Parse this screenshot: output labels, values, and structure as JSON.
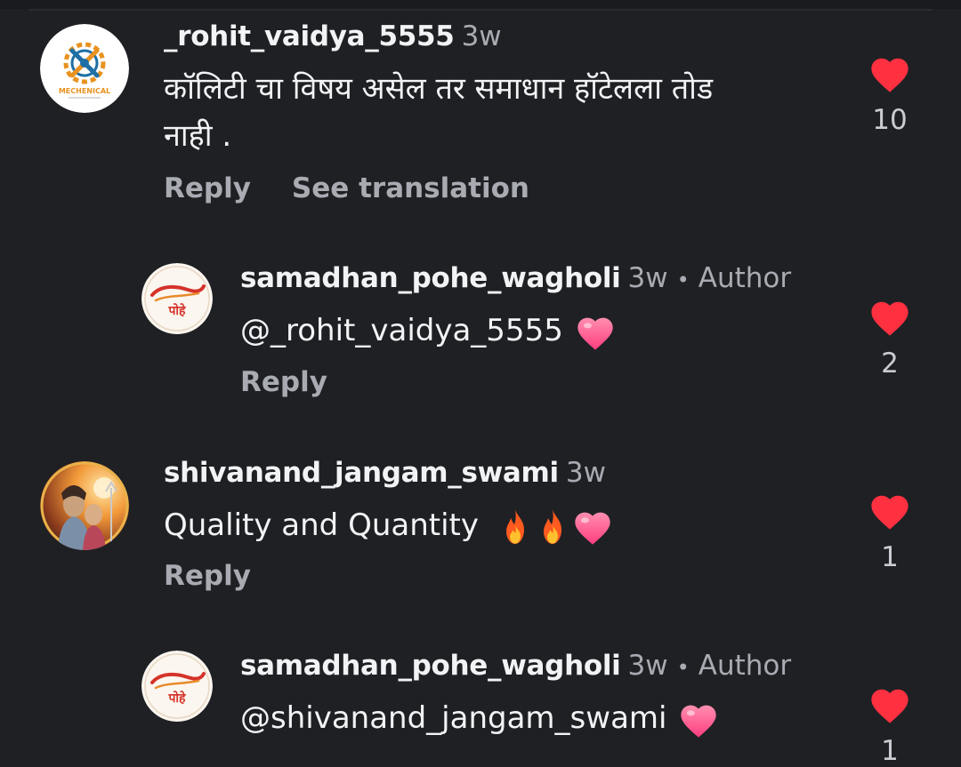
{
  "colors": {
    "background": "#1f2024",
    "text_primary": "#f2f3f5",
    "text_secondary": "#a8abb2",
    "like_heart": "#ff3040"
  },
  "comments": [
    {
      "username": "_rohit_vaidya_5555",
      "time": "3w",
      "text_line1": "कॉलिटी चा विषय असेल तर समाधान हॉटेलला  तोड",
      "text_line2": "नाही .",
      "reply_label": "Reply",
      "translate_label": "See translation",
      "like_count": "10",
      "avatar_icon": "mechanical-logo-avatar",
      "avatar_text": "MECHENICAL"
    },
    {
      "username": "samadhan_pohe_wagholi",
      "time": "3w",
      "separator": "•",
      "author_label": "Author",
      "text": "@_rohit_vaidya_5555",
      "reply_label": "Reply",
      "like_count": "2",
      "avatar_icon": "samadhan-pohe-logo-avatar",
      "avatar_text": "पोहे"
    },
    {
      "username": "shivanand_jangam_swami",
      "time": "3w",
      "text": "Quality and Quantity",
      "reply_label": "Reply",
      "like_count": "1",
      "avatar_icon": "deity-portrait-avatar"
    },
    {
      "username": "samadhan_pohe_wagholi",
      "time": "3w",
      "separator": "•",
      "author_label": "Author",
      "text": "@shivanand_jangam_swami",
      "like_count": "1",
      "avatar_icon": "samadhan-pohe-logo-avatar",
      "avatar_text": "पोहे"
    }
  ]
}
